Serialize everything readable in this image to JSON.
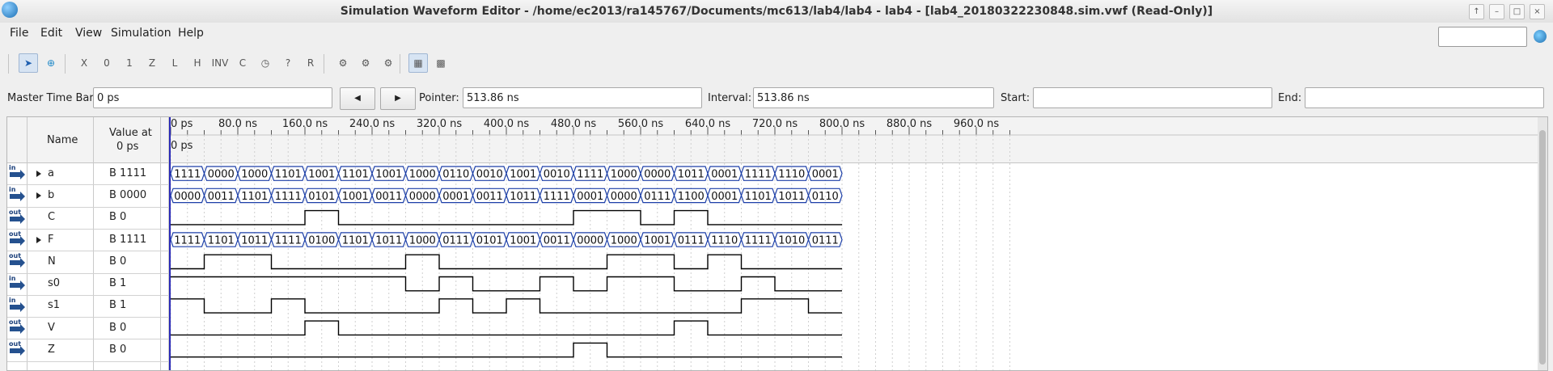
{
  "window": {
    "title": "Simulation Waveform Editor - /home/ec2013/ra145767/Documents/mc613/lab4/lab4 - lab4 - [lab4_20180322230848.sim.vwf (Read-Only)]"
  },
  "menu": [
    "File",
    "Edit",
    "View",
    "Simulation",
    "Help"
  ],
  "toolbar": {
    "icons": [
      "pointer-tool-icon",
      "zoom-tool-icon",
      "force-unknown-icon",
      "force-low-icon",
      "force-high-icon",
      "force-high-impedance-icon",
      "force-weak-low-icon",
      "force-weak-high-icon",
      "invert-icon",
      "count-value-icon",
      "clock-value-icon",
      "random-value-icon",
      "arbitrary-value-icon",
      "run-functional-simulation-icon",
      "run-timing-simulation-icon",
      "generate-netlist-icon",
      "snap-to-grid-icon",
      "grid-settings-icon"
    ],
    "glyphs": [
      "➤",
      "⊕",
      "X",
      "0",
      "1",
      "Z",
      "L",
      "H",
      "INV",
      "C",
      "◷",
      "?",
      "R",
      "⚙",
      "⚙",
      "⚙",
      "▦",
      "▩"
    ]
  },
  "fields": {
    "master_label": "Master Time Bar:",
    "master_value": "0 ps",
    "pointer_label": "Pointer:",
    "pointer_value": "513.86 ns",
    "interval_label": "Interval:",
    "interval_value": "513.86 ns",
    "start_label": "Start:",
    "start_value": "",
    "end_label": "End:",
    "end_value": ""
  },
  "grid": {
    "name_header": "Name",
    "value_header_line1": "Value at",
    "value_header_line2": "0 ps",
    "cursor_label": "0 ps"
  },
  "timeline": {
    "ticks": [
      "0 ps",
      "80.0 ns",
      "160.0 ns",
      "240.0 ns",
      "320.0 ns",
      "400.0 ns",
      "480.0 ns",
      "560.0 ns",
      "640.0 ns",
      "720.0 ns",
      "800.0 ns",
      "880.0 ns",
      "960.0 ns"
    ],
    "segment_ns": 40,
    "visible_end_ns": 1000
  },
  "signals": [
    {
      "name": "a",
      "io": "in",
      "expandable": true,
      "value": "B 1111",
      "type": "bus",
      "segments": [
        "1111",
        "0000",
        "1000",
        "1101",
        "1001",
        "1101",
        "1001",
        "1000",
        "0110",
        "0010",
        "1001",
        "0010",
        "1111",
        "1000",
        "0000",
        "1011",
        "0001",
        "1111",
        "1110",
        "0001"
      ]
    },
    {
      "name": "b",
      "io": "in",
      "expandable": true,
      "value": "B 0000",
      "type": "bus",
      "segments": [
        "0000",
        "0011",
        "1101",
        "1111",
        "0101",
        "1001",
        "0011",
        "0000",
        "0001",
        "0011",
        "1011",
        "1111",
        "0001",
        "0000",
        "0111",
        "1100",
        "0001",
        "1101",
        "1011",
        "0110"
      ]
    },
    {
      "name": "C",
      "io": "out",
      "expandable": false,
      "value": "B 0",
      "type": "bit",
      "bits": [
        0,
        0,
        0,
        0,
        1,
        0,
        0,
        0,
        0,
        0,
        0,
        0,
        1,
        1,
        0,
        1,
        0,
        0,
        0,
        0
      ]
    },
    {
      "name": "F",
      "io": "out",
      "expandable": true,
      "value": "B 1111",
      "type": "bus",
      "segments": [
        "1111",
        "1101",
        "1011",
        "1111",
        "0100",
        "1101",
        "1011",
        "1000",
        "0111",
        "0101",
        "1001",
        "0011",
        "0000",
        "1000",
        "1001",
        "0111",
        "1110",
        "1111",
        "1010",
        "0111"
      ]
    },
    {
      "name": "N",
      "io": "out",
      "expandable": false,
      "value": "B 0",
      "type": "bit",
      "bits": [
        0,
        1,
        1,
        0,
        0,
        0,
        0,
        1,
        0,
        0,
        0,
        0,
        0,
        1,
        1,
        0,
        1,
        0,
        0,
        0
      ]
    },
    {
      "name": "s0",
      "io": "in",
      "expandable": false,
      "value": "B 1",
      "type": "bit",
      "bits": [
        1,
        1,
        1,
        1,
        1,
        1,
        1,
        0,
        1,
        0,
        0,
        1,
        0,
        1,
        1,
        0,
        0,
        1,
        0,
        0
      ]
    },
    {
      "name": "s1",
      "io": "in",
      "expandable": false,
      "value": "B 1",
      "type": "bit",
      "bits": [
        1,
        0,
        0,
        1,
        0,
        0,
        0,
        0,
        1,
        0,
        1,
        0,
        0,
        0,
        0,
        0,
        0,
        1,
        1,
        0
      ]
    },
    {
      "name": "V",
      "io": "out",
      "expandable": false,
      "value": "B 0",
      "type": "bit",
      "bits": [
        0,
        0,
        0,
        0,
        1,
        0,
        0,
        0,
        0,
        0,
        0,
        0,
        0,
        0,
        0,
        1,
        0,
        0,
        0,
        0
      ]
    },
    {
      "name": "Z",
      "io": "out",
      "expandable": false,
      "value": "B 0",
      "type": "bit",
      "bits": [
        0,
        0,
        0,
        0,
        0,
        0,
        0,
        0,
        0,
        0,
        0,
        0,
        1,
        0,
        0,
        0,
        0,
        0,
        0,
        0
      ]
    }
  ],
  "colors": {
    "bus": "#1c3fa8",
    "bit": "#000000",
    "cursor": "#2a2ab8",
    "grid": "#cfcfcf"
  }
}
